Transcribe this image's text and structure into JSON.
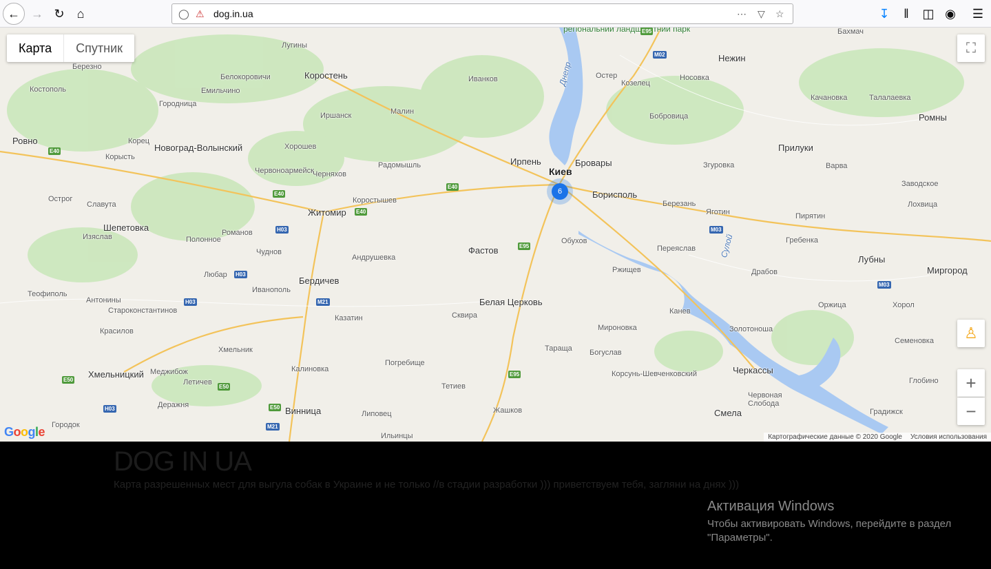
{
  "browser": {
    "url": "dog.in.ua"
  },
  "map": {
    "map_types": [
      "Карта",
      "Спутник"
    ],
    "cluster_count": "6",
    "attribution": "Картографические данные © 2020 Google",
    "terms": "Условия использования",
    "google_logo": "Google",
    "cities": [
      {
        "name": "Киев",
        "cls": "huge"
      },
      {
        "name": "Бровары",
        "cls": "big"
      },
      {
        "name": "Ирпень",
        "cls": "big"
      },
      {
        "name": "Борисполь",
        "cls": "big"
      },
      {
        "name": "Житомир",
        "cls": "big"
      },
      {
        "name": "Новоград-Волынский",
        "cls": "big"
      },
      {
        "name": "Ровно",
        "cls": "big"
      },
      {
        "name": "Коростень",
        "cls": "big"
      },
      {
        "name": "Бердичев",
        "cls": "big"
      },
      {
        "name": "Белая Церковь",
        "cls": "big"
      },
      {
        "name": "Фастов",
        "cls": "big"
      },
      {
        "name": "Хмельницкий",
        "cls": "big"
      },
      {
        "name": "Винница",
        "cls": "big"
      },
      {
        "name": "Черкассы",
        "cls": "big"
      },
      {
        "name": "Смела",
        "cls": "big"
      },
      {
        "name": "Нежин",
        "cls": "big"
      },
      {
        "name": "Прилуки",
        "cls": "big"
      },
      {
        "name": "Ромны",
        "cls": "big"
      },
      {
        "name": "Лубны",
        "cls": "big"
      },
      {
        "name": "Миргород",
        "cls": "big"
      },
      {
        "name": "Шепетовка",
        "cls": "big"
      },
      {
        "name": "Славута",
        "cls": ""
      },
      {
        "name": "Малин",
        "cls": ""
      },
      {
        "name": "Обухов",
        "cls": ""
      },
      {
        "name": "Переяслав",
        "cls": ""
      },
      {
        "name": "Канев",
        "cls": ""
      },
      {
        "name": "Ржищев",
        "cls": ""
      },
      {
        "name": "Казатин",
        "cls": ""
      },
      {
        "name": "Сквира",
        "cls": ""
      },
      {
        "name": "Коростышев",
        "cls": ""
      },
      {
        "name": "Радомышль",
        "cls": ""
      },
      {
        "name": "Иванков",
        "cls": ""
      },
      {
        "name": "Остер",
        "cls": ""
      },
      {
        "name": "Козелец",
        "cls": ""
      },
      {
        "name": "Носовка",
        "cls": ""
      },
      {
        "name": "Бобровица",
        "cls": ""
      },
      {
        "name": "Згуровка",
        "cls": ""
      },
      {
        "name": "Яготин",
        "cls": ""
      },
      {
        "name": "Березань",
        "cls": ""
      },
      {
        "name": "Пирятин",
        "cls": ""
      },
      {
        "name": "Гребенка",
        "cls": ""
      },
      {
        "name": "Драбов",
        "cls": ""
      },
      {
        "name": "Золотоноша",
        "cls": ""
      },
      {
        "name": "Мироновка",
        "cls": ""
      },
      {
        "name": "Богуслав",
        "cls": ""
      },
      {
        "name": "Корсунь-Шевченковский",
        "cls": ""
      },
      {
        "name": "Тараща",
        "cls": ""
      },
      {
        "name": "Тетиев",
        "cls": ""
      },
      {
        "name": "Жашков",
        "cls": ""
      },
      {
        "name": "Погребище",
        "cls": ""
      },
      {
        "name": "Калиновка",
        "cls": ""
      },
      {
        "name": "Липовец",
        "cls": ""
      },
      {
        "name": "Ильинцы",
        "cls": ""
      },
      {
        "name": "Андрушевка",
        "cls": ""
      },
      {
        "name": "Чуднов",
        "cls": ""
      },
      {
        "name": "Романов",
        "cls": ""
      },
      {
        "name": "Любар",
        "cls": ""
      },
      {
        "name": "Иванополь",
        "cls": ""
      },
      {
        "name": "Полонное",
        "cls": ""
      },
      {
        "name": "Изяслав",
        "cls": ""
      },
      {
        "name": "Теофиполь",
        "cls": ""
      },
      {
        "name": "Антонины",
        "cls": ""
      },
      {
        "name": "Староконстантинов",
        "cls": ""
      },
      {
        "name": "Красилов",
        "cls": ""
      },
      {
        "name": "Хмельник",
        "cls": ""
      },
      {
        "name": "Меджибож",
        "cls": ""
      },
      {
        "name": "Летичев",
        "cls": ""
      },
      {
        "name": "Деражня",
        "cls": ""
      },
      {
        "name": "Городок",
        "cls": ""
      },
      {
        "name": "Острог",
        "cls": ""
      },
      {
        "name": "Корец",
        "cls": ""
      },
      {
        "name": "Корысть",
        "cls": ""
      },
      {
        "name": "Городница",
        "cls": ""
      },
      {
        "name": "Костополь",
        "cls": ""
      },
      {
        "name": "Березно",
        "cls": ""
      },
      {
        "name": "Емильчино",
        "cls": ""
      },
      {
        "name": "Белокоровичи",
        "cls": ""
      },
      {
        "name": "Лугины",
        "cls": ""
      },
      {
        "name": "Иршанск",
        "cls": ""
      },
      {
        "name": "Хорошев",
        "cls": ""
      },
      {
        "name": "Червоноармейск",
        "cls": ""
      },
      {
        "name": "Черняхов",
        "cls": ""
      },
      {
        "name": "Качановка",
        "cls": ""
      },
      {
        "name": "Талалаевка",
        "cls": ""
      },
      {
        "name": "Варва",
        "cls": ""
      },
      {
        "name": "Заводское",
        "cls": ""
      },
      {
        "name": "Лохвица",
        "cls": ""
      },
      {
        "name": "Оржица",
        "cls": ""
      },
      {
        "name": "Хорол",
        "cls": ""
      },
      {
        "name": "Семеновка",
        "cls": ""
      },
      {
        "name": "Глобино",
        "cls": ""
      },
      {
        "name": "Градижск",
        "cls": ""
      },
      {
        "name": "Червоная Слобода",
        "cls": ""
      },
      {
        "name": "Бахмач",
        "cls": ""
      }
    ],
    "park_label": "регіональний ландшафтний парк",
    "river_labels": [
      "Днепр",
      "Сулой"
    ]
  },
  "page": {
    "title": "DOG IN UA",
    "subtitle": "Карта разрешенных мест для выгула собак в Украине и не только //в стадии разработки ))) приветствуем тебя, загляни на днях )))"
  },
  "windows": {
    "heading": "Активация Windows",
    "text": "Чтобы активировать Windows, перейдите в раздел \"Параметры\"."
  }
}
